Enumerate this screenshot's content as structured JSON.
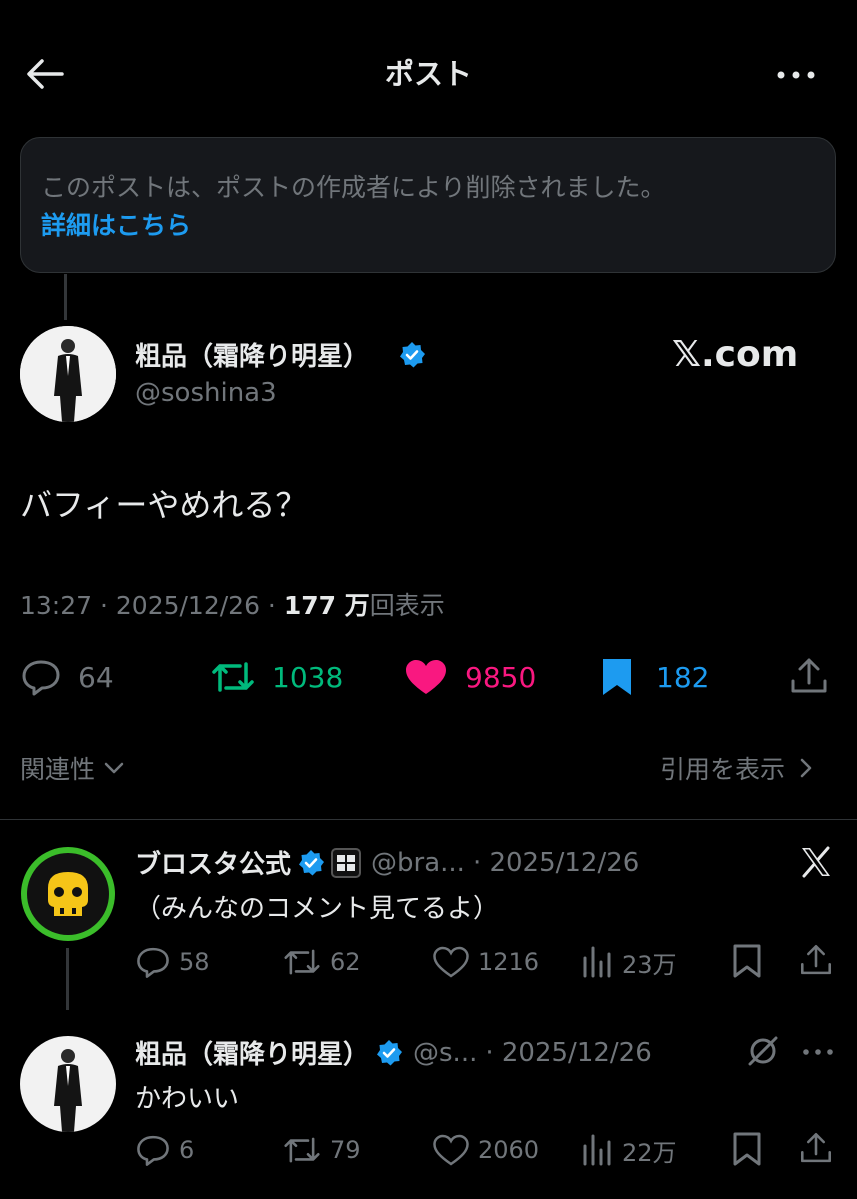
{
  "header": {
    "title": "ポスト"
  },
  "notice": {
    "text": "このポストは、ポストの作成者により削除されました。",
    "link": "詳細はこちら"
  },
  "post": {
    "author_name": "粗品（霜降り明星）",
    "handle": "@soshina3",
    "watermark": "𝕏.com",
    "text": "バフィーやめれる？",
    "time": "13:27",
    "date": "2025/12/26",
    "views_count": "177 万",
    "views_label": "回表示",
    "replies": "64",
    "reposts": "1038",
    "likes": "9850",
    "bookmarks": "182"
  },
  "sort": {
    "label": "関連性",
    "quotes_label": "引用を表示"
  },
  "replies": [
    {
      "author_name": "ブロスタ公式",
      "handle": "@bra...",
      "date": "· 2025/12/26",
      "text": "（みんなのコメント見てるよ）",
      "replies": "58",
      "reposts": "62",
      "likes": "1216",
      "views": "23万"
    },
    {
      "author_name": "粗品（霜降り明星）",
      "handle": "@s...",
      "date": "· 2025/12/26",
      "text": "かわいい",
      "replies": "6",
      "reposts": "79",
      "likes": "2060",
      "views": "22万"
    }
  ],
  "colors": {
    "accent": "#1d9bf0",
    "repost": "#00ba7c",
    "like": "#f91880",
    "muted": "#71767b",
    "background": "#000000"
  }
}
